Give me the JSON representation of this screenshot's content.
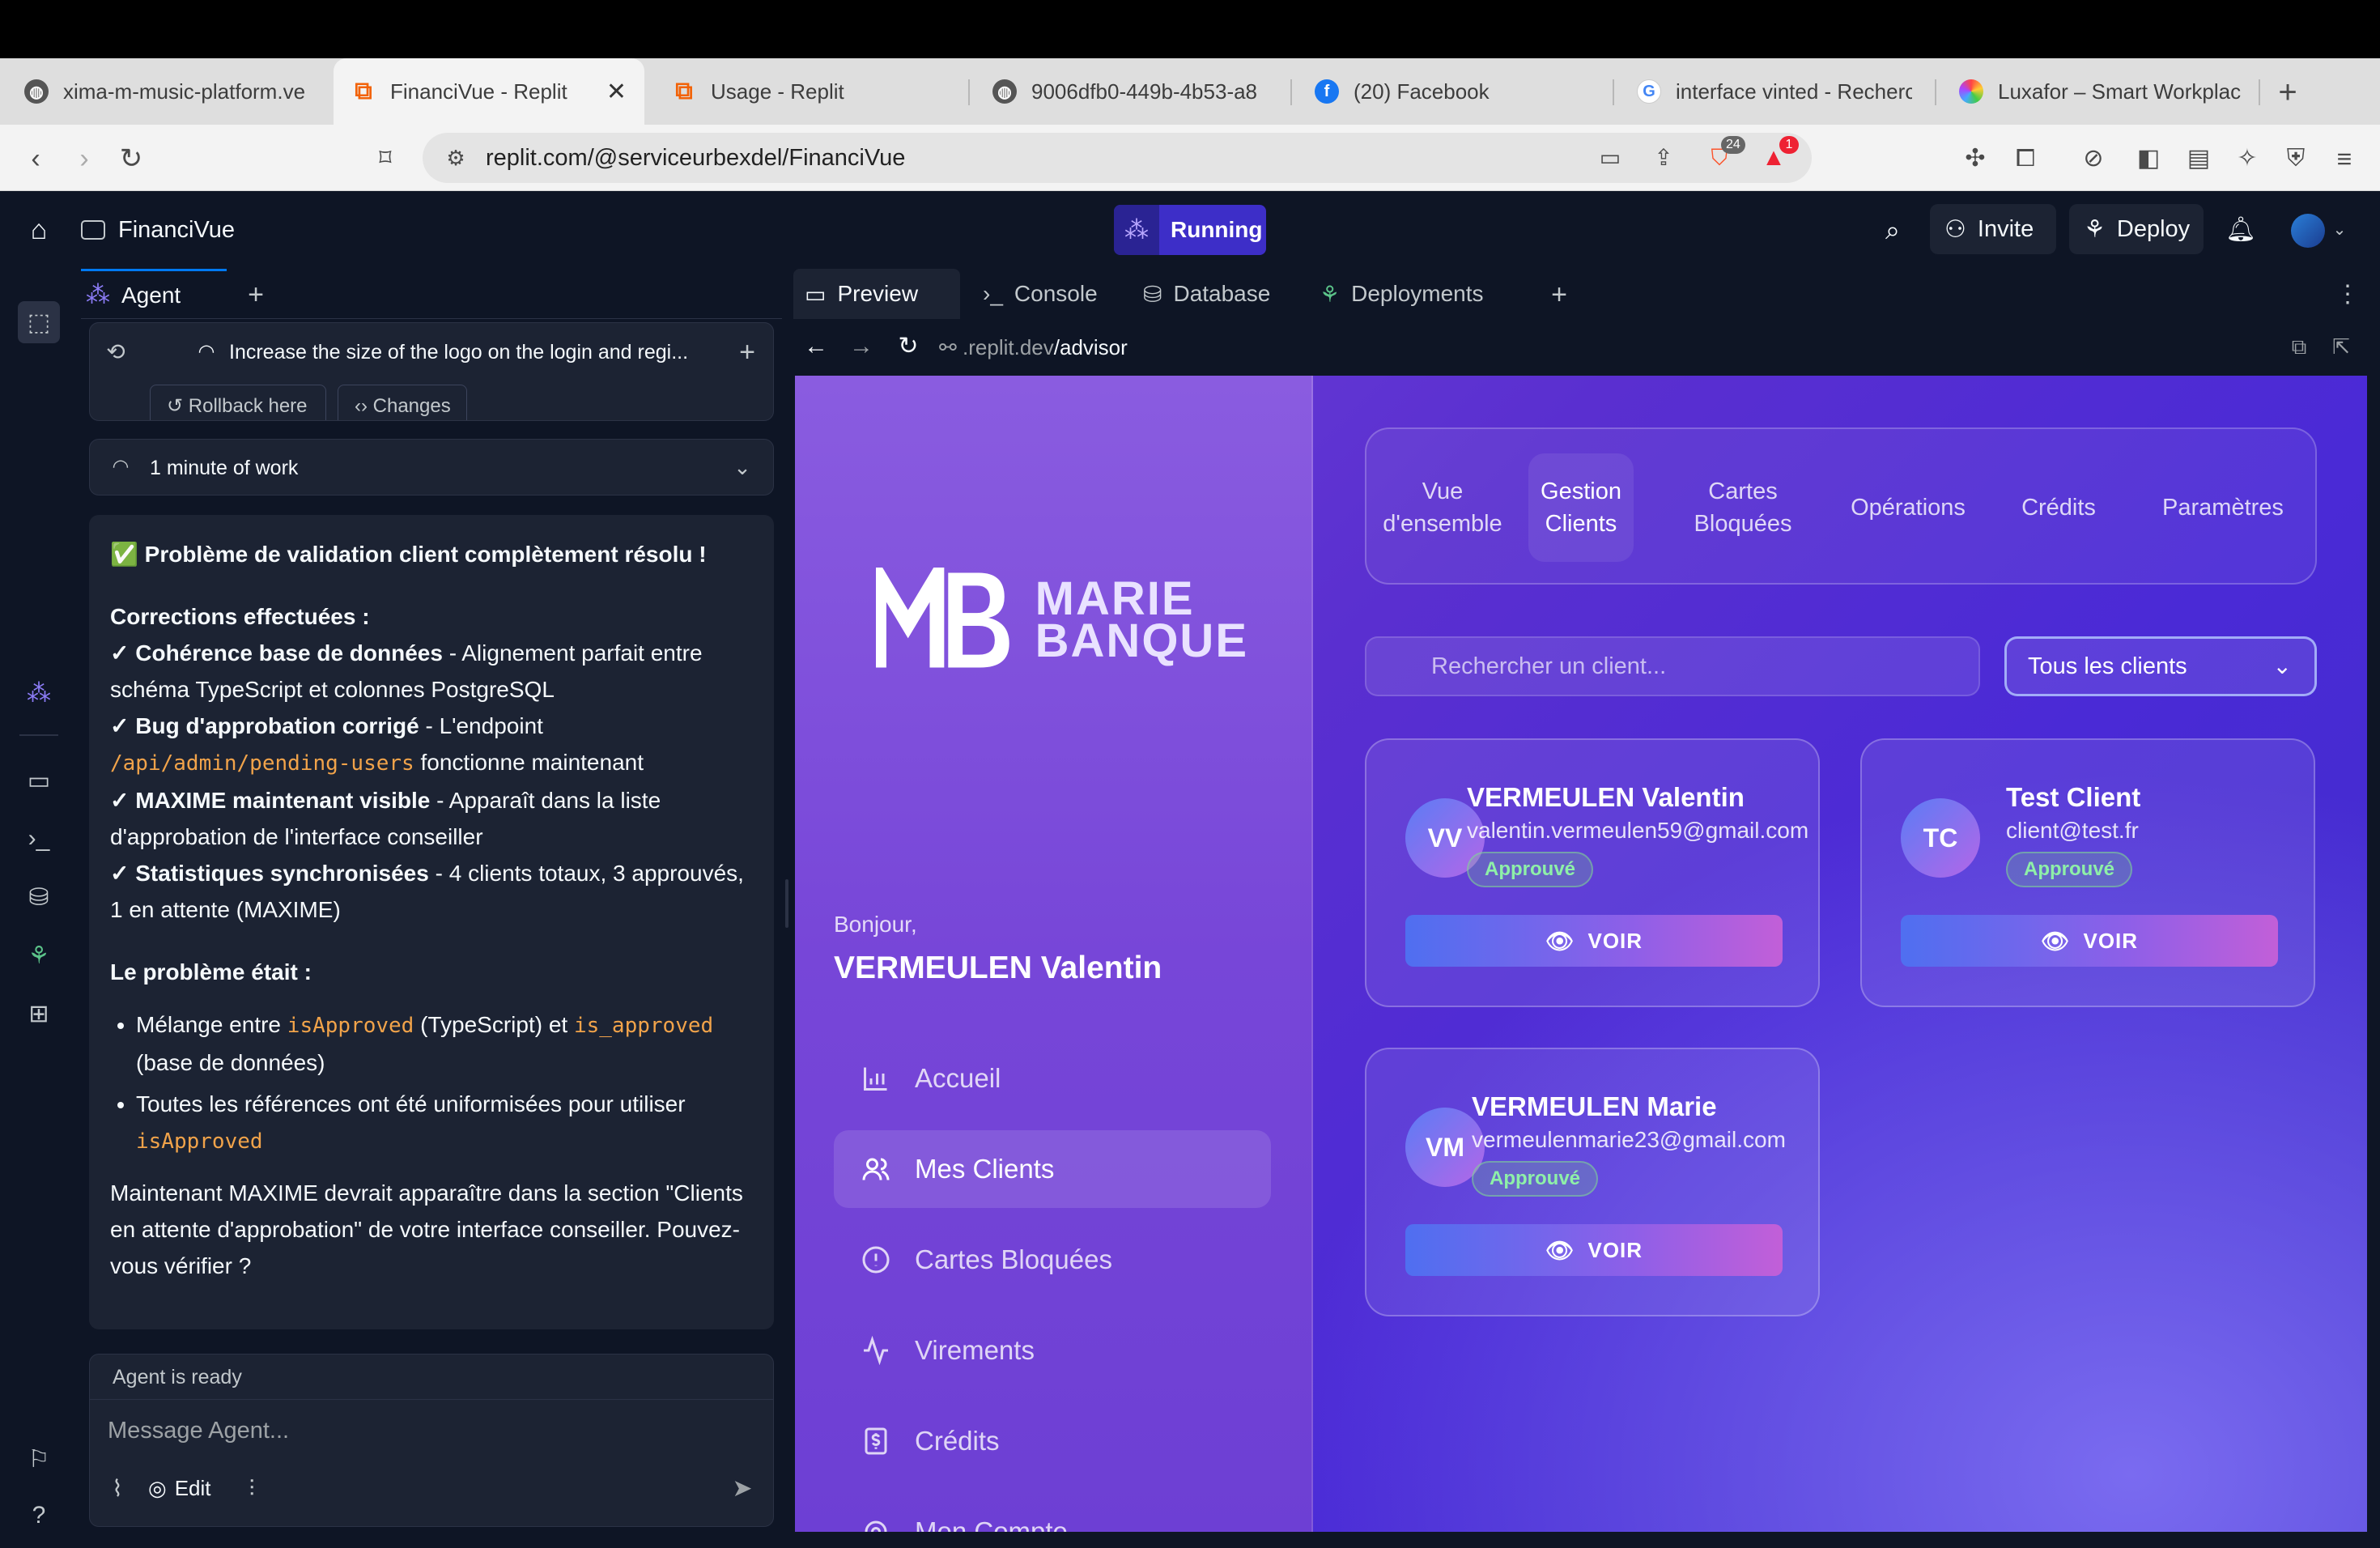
{
  "browser": {
    "tabs": [
      {
        "title": "xima-m-music-platform.ve",
        "icon": "globe-icon"
      },
      {
        "title": "FinanciVue - Replit",
        "icon": "replit-icon",
        "active": true
      },
      {
        "title": "Usage - Replit",
        "icon": "replit-icon"
      },
      {
        "title": "9006dfb0-449b-4b53-a8",
        "icon": "globe-icon"
      },
      {
        "title": "(20) Facebook",
        "icon": "facebook-icon"
      },
      {
        "title": "interface vinted - Recherch",
        "icon": "google-icon"
      },
      {
        "title": "Luxafor – Smart Workplac",
        "icon": "luxafor-icon"
      }
    ],
    "url": "replit.com/@serviceurbexdel/FinanciVue",
    "brave_badge": "24",
    "alert_badge": "1"
  },
  "replit": {
    "project_name": "FinanciVue",
    "run_status": "Running",
    "invite_label": "Invite",
    "deploy_label": "Deploy",
    "agent": {
      "tab_label": "Agent",
      "history_title": "Increase the size of the logo on the login and regi...",
      "rollback_label": "Rollback here",
      "changes_label": "Changes",
      "work_time": "1 minute of work",
      "message": {
        "title": "✅ Problème de validation client complètement résolu !",
        "corrections_heading": "Corrections effectuées :",
        "c1_bold": "✓ Cohérence base de données",
        "c1_text": " - Alignement parfait entre schéma TypeScript et colonnes PostgreSQL",
        "c2_bold": "✓ Bug d'approbation corrigé",
        "c2_text": " - L'endpoint ",
        "c2_code": "/api/admin/pending-users",
        "c2_text2": " fonctionne maintenant",
        "c3_bold": "✓ MAXIME maintenant visible",
        "c3_text": " - Apparaît dans la liste d'approbation de l'interface conseiller",
        "c4_bold": "✓ Statistiques synchronisées",
        "c4_text": " - 4 clients totaux, 3 approuvés, 1 en attente (MAXIME)",
        "problem_heading": "Le problème était :",
        "b1_pre": "Mélange entre ",
        "b1_code1": "isApproved",
        "b1_mid": " (TypeScript) et ",
        "b1_code2": "is_approved",
        "b1_post": " (base de données)",
        "b2_pre": "Toutes les références ont été uniformisées pour utiliser ",
        "b2_code": "isApproved",
        "closing": "Maintenant MAXIME devrait apparaître dans la section \"Clients en attente d'approbation\" de votre interface conseiller. Pouvez-vous vérifier ?"
      },
      "status": "Agent is ready",
      "input_placeholder": "Message Agent...",
      "edit_label": "Edit"
    },
    "preview": {
      "tabs": [
        "Preview",
        "Console",
        "Database",
        "Deployments"
      ],
      "url_prefix": ".replit.dev",
      "url_path": "/advisor"
    }
  },
  "app": {
    "logo_line1": "MARIE",
    "logo_line2": "BANQUE",
    "greeting": "Bonjour,",
    "user_name": "VERMEULEN Valentin",
    "side_nav": [
      "Accueil",
      "Mes Clients",
      "Cartes Bloquées",
      "Virements",
      "Crédits",
      "Mon Compte"
    ],
    "top_nav": [
      {
        "line1": "Vue",
        "line2": "d'ensemble"
      },
      {
        "line1": "Gestion",
        "line2": "Clients"
      },
      {
        "line1": "Cartes",
        "line2": "Bloquées"
      },
      {
        "line1": "Opérations",
        "line2": ""
      },
      {
        "line1": "Crédits",
        "line2": ""
      },
      {
        "line1": "Paramètres",
        "line2": ""
      }
    ],
    "search_placeholder": "Rechercher un client...",
    "filter_value": "Tous les clients",
    "clients": [
      {
        "initials": "VV",
        "name": "VERMEULEN Valentin",
        "email": "valentin.vermeulen59@gmail.com",
        "status": "Approuvé",
        "action": "VOIR"
      },
      {
        "initials": "TC",
        "name": "Test Client",
        "email": "client@test.fr",
        "status": "Approuvé",
        "action": "VOIR"
      },
      {
        "initials": "VM",
        "name": "VERMEULEN Marie",
        "email": "vermeulenmarie23@gmail.com",
        "status": "Approuvé",
        "action": "VOIR"
      }
    ]
  }
}
